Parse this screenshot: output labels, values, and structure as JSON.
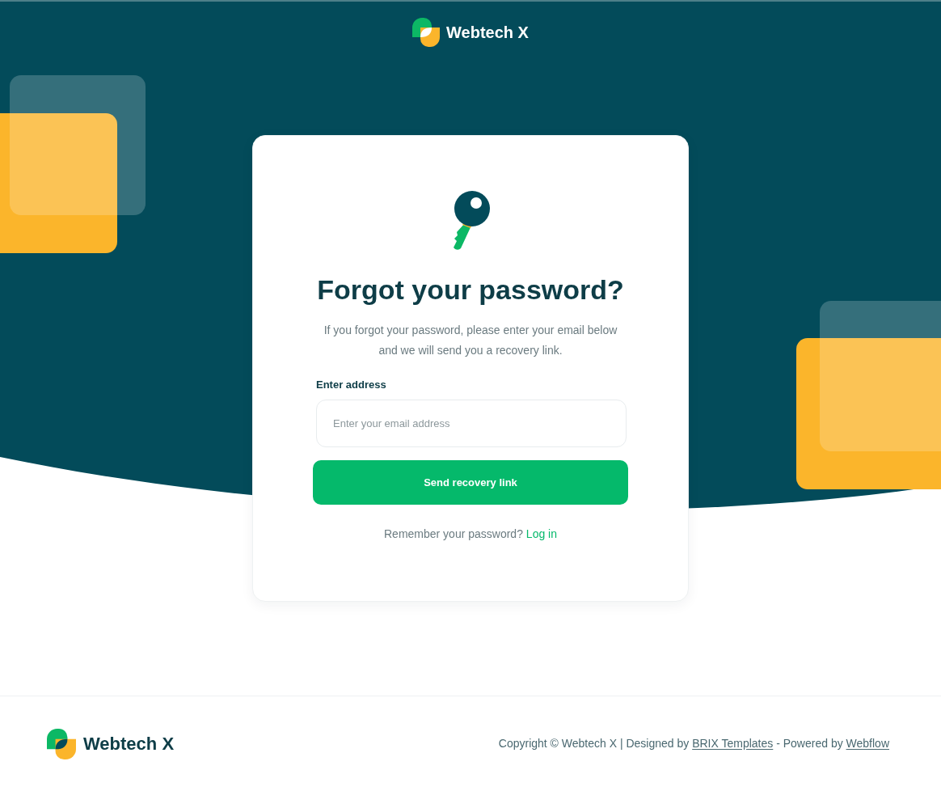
{
  "header": {
    "logo_text": "Webtech X"
  },
  "card": {
    "title": "Forgot your password?",
    "description": "If you forgot your password, please enter your email below and we will send you a recovery link.",
    "email_field": {
      "label": "Enter address",
      "placeholder": "Enter your email address"
    },
    "submit_button": "Send recovery link",
    "login_prompt": {
      "text": "Remember your password?",
      "link": "Log in"
    }
  },
  "footer": {
    "logo_text": "Webtech X",
    "copyright": {
      "text": "Copyright © Webtech X | Designed by",
      "link_1": "BRIX Templates",
      "separator": "- Powered by",
      "link_2": "Webflow"
    }
  }
}
